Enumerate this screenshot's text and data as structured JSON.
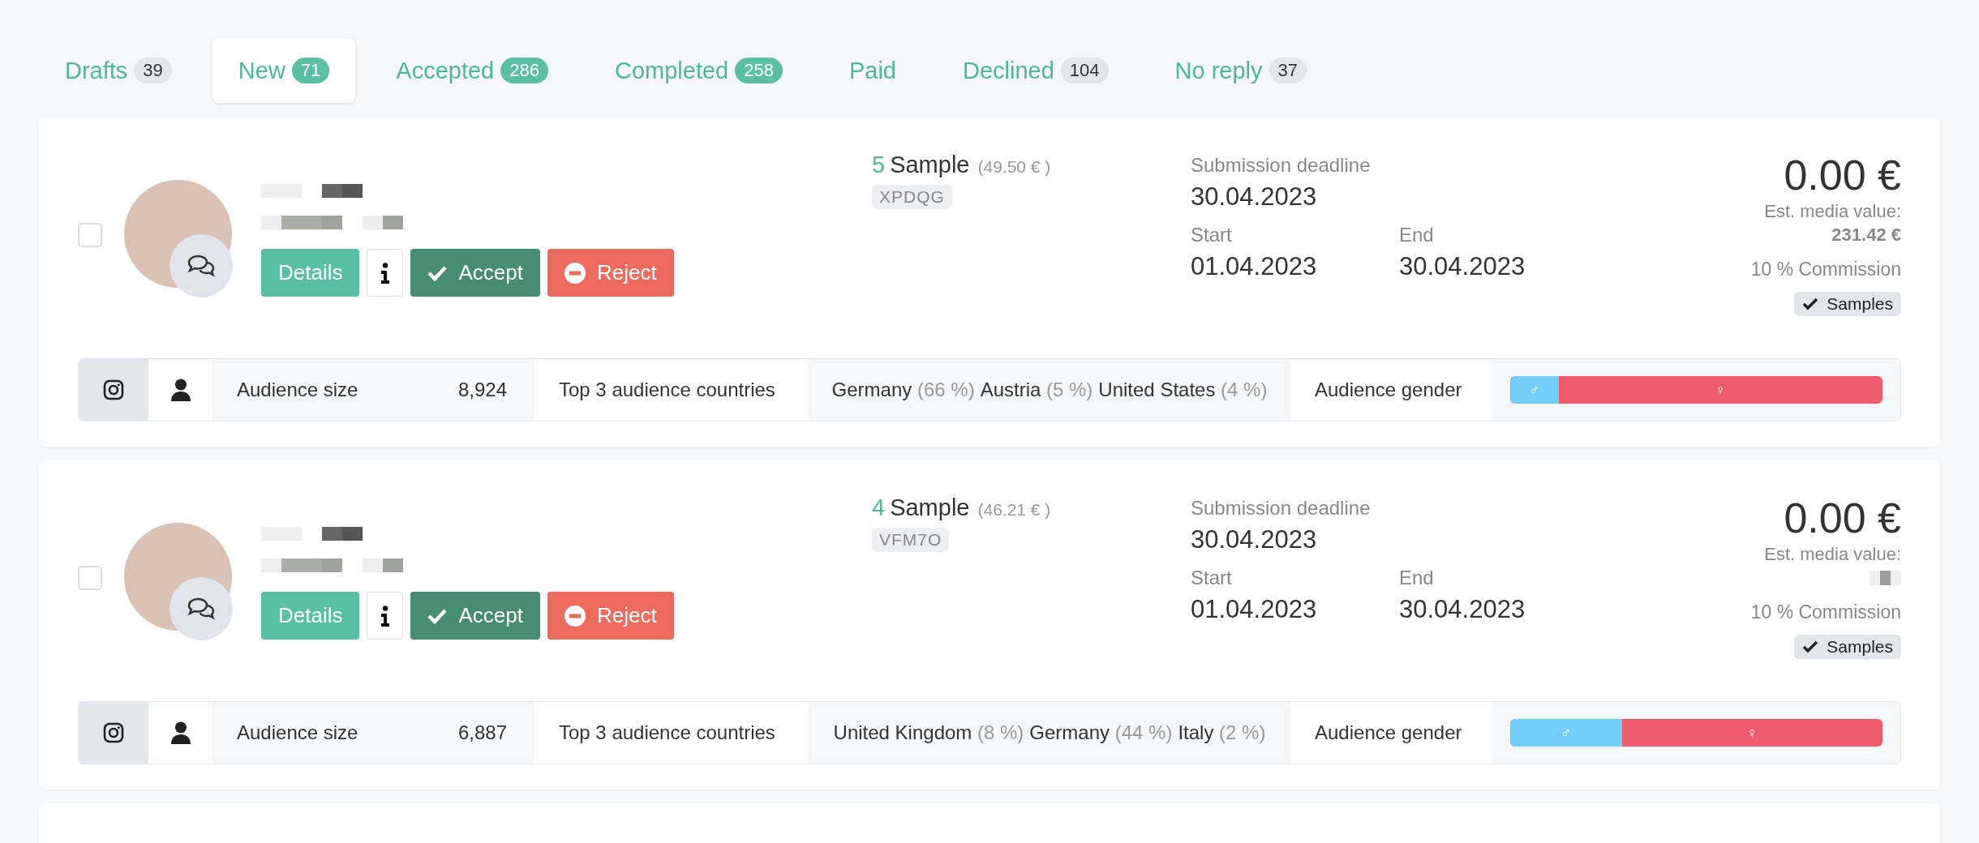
{
  "tabs": [
    {
      "label": "Drafts",
      "count": "39",
      "kind": "neutral",
      "selected": false
    },
    {
      "label": "New",
      "count": "71",
      "kind": "accent",
      "selected": true
    },
    {
      "label": "Accepted",
      "count": "286",
      "kind": "accent",
      "selected": false
    },
    {
      "label": "Completed",
      "count": "258",
      "kind": "accent",
      "selected": false
    },
    {
      "label": "Paid",
      "selected": false
    },
    {
      "label": "Declined",
      "count": "104",
      "kind": "neutral",
      "selected": false
    },
    {
      "label": "No reply",
      "count": "37",
      "kind": "neutral",
      "selected": false
    }
  ],
  "offers": [
    {
      "checked": false,
      "buttons": {
        "details": "Details",
        "accept": "Accept",
        "reject": "Reject"
      },
      "quantity": "5",
      "product": "Sample",
      "price": "(49.50 € )",
      "code": "XPDQG",
      "deadline_label": "Submission deadline",
      "deadline": "30.04.2023",
      "start_label": "Start",
      "start": "01.04.2023",
      "end_label": "End",
      "end": "30.04.2023",
      "amount": "0.00 €",
      "media_value_label": "Est. media value:",
      "media_value": "231.42 €",
      "commission": "10 % Commission",
      "samples": "Samples",
      "audience": {
        "size_label": "Audience size",
        "size": "8,924",
        "countries_label": "Top 3 audience countries",
        "countries": [
          {
            "name": "Germany",
            "share": "(66 %)"
          },
          {
            "name": "Austria",
            "share": "(5 %)"
          },
          {
            "name": "United States",
            "share": "(4 %)"
          }
        ],
        "gender_label": "Audience gender",
        "gender": {
          "level": 0.13,
          "male": "♂",
          "female": "♀"
        }
      }
    },
    {
      "checked": false,
      "buttons": {
        "details": "Details",
        "accept": "Accept",
        "reject": "Reject"
      },
      "quantity": "4",
      "product": "Sample",
      "price": "(46.21 € )",
      "code": "VFM7O",
      "deadline_label": "Submission deadline",
      "deadline": "30.04.2023",
      "start_label": "Start",
      "start": "01.04.2023",
      "end_label": "End",
      "end": "30.04.2023",
      "amount": "0.00 €",
      "media_value_label": "Est. media value:",
      "commission": "10 % Commission",
      "samples": "Samples",
      "audience": {
        "size_label": "Audience size",
        "size": "6,887",
        "countries_label": "Top 3 audience countries",
        "countries": [
          {
            "name": "United Kingdom",
            "share": "(8 %)"
          },
          {
            "name": "Germany",
            "share": "(44 %)"
          },
          {
            "name": "Italy",
            "share": "(2 %)"
          }
        ],
        "gender_label": "Audience gender",
        "gender": {
          "level": 0.3,
          "male": "♂",
          "female": "♀"
        }
      }
    }
  ]
}
